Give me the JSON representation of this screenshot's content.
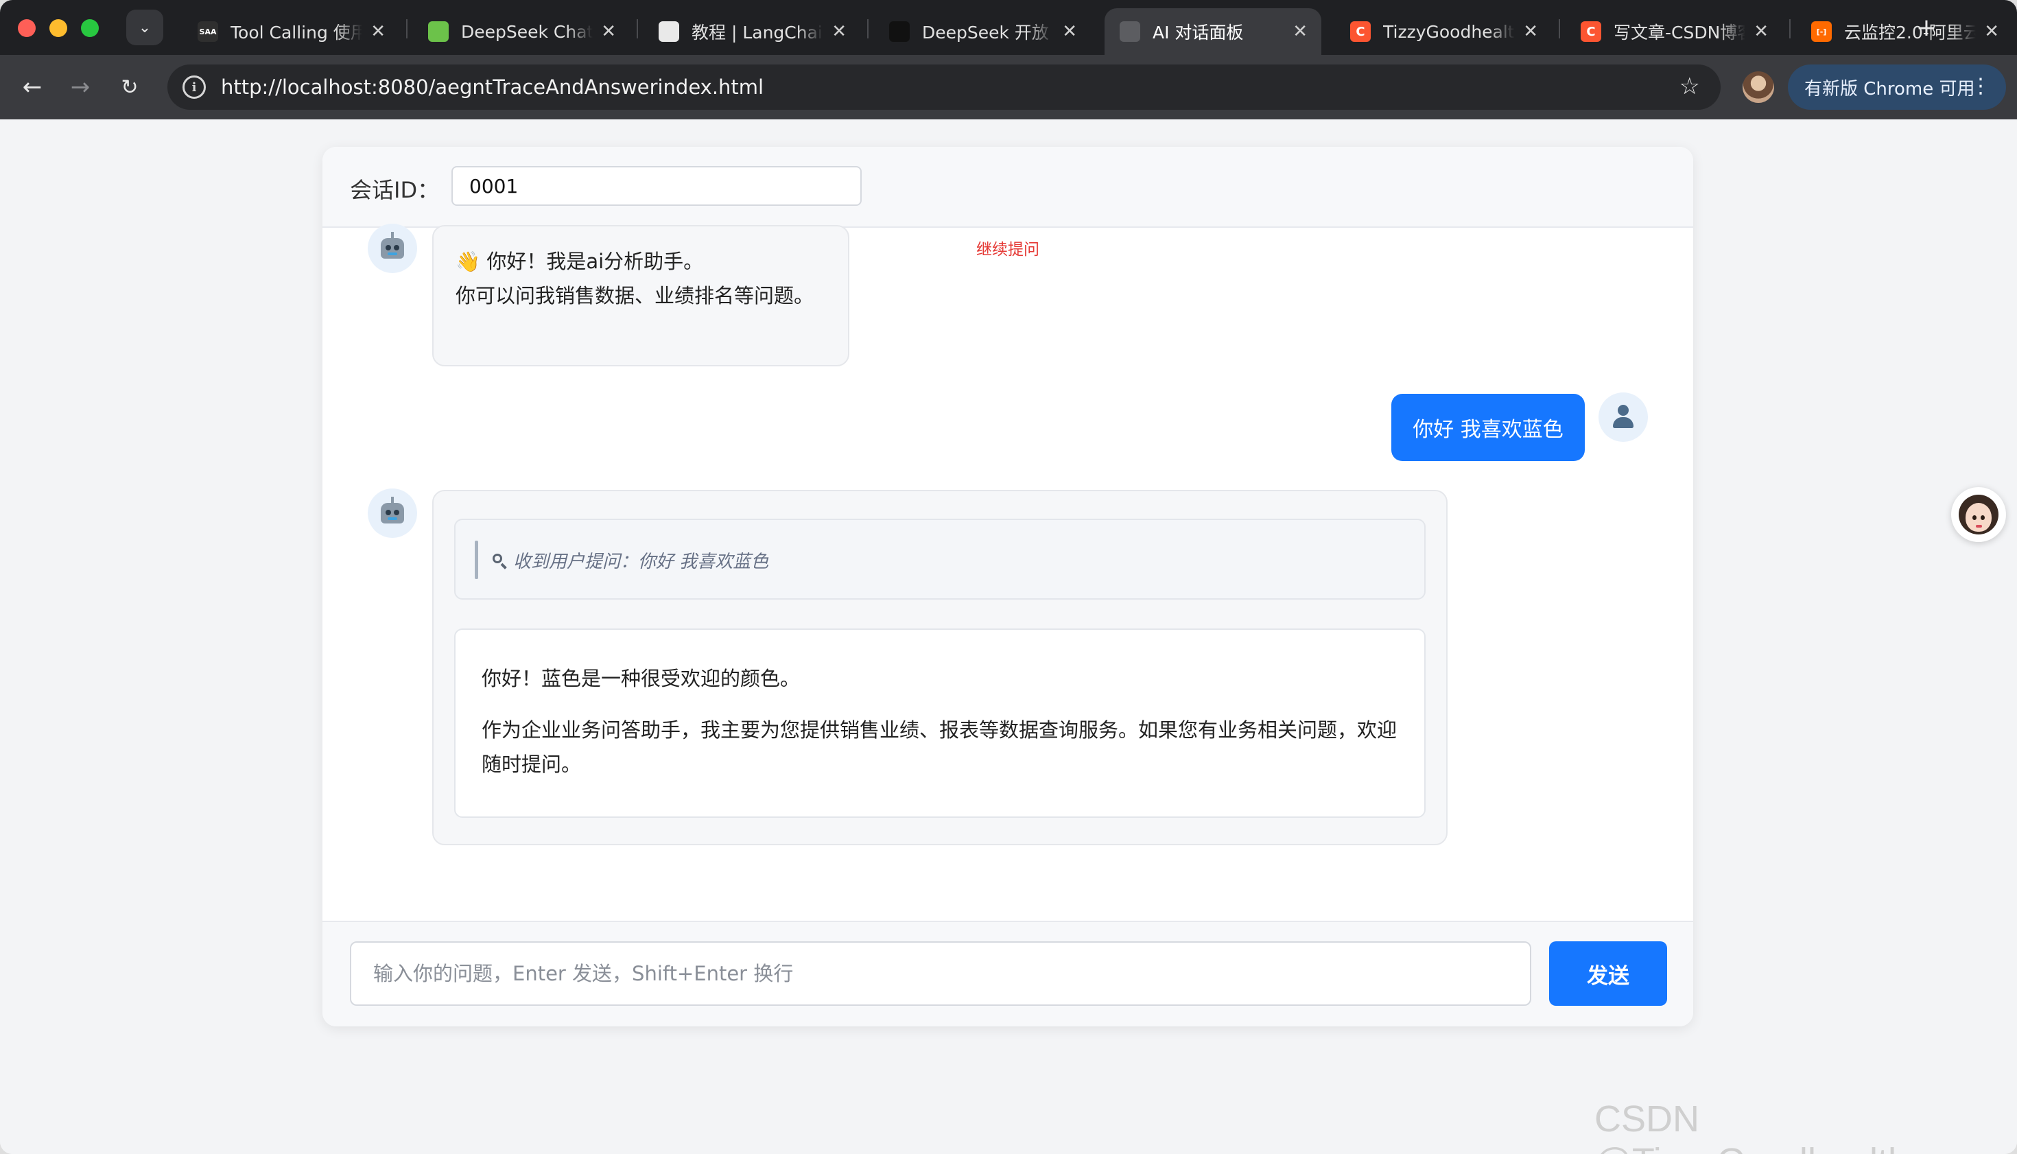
{
  "browser": {
    "tabs": [
      {
        "title": "Tool Calling 使用",
        "favicon_text": "SAA",
        "favicon_color": "#2f2f2f",
        "active": false
      },
      {
        "title": "DeepSeek Chat",
        "favicon_text": "",
        "favicon_color": "#6cc24a",
        "active": false
      },
      {
        "title": "教程 | LangChain",
        "favicon_text": "",
        "favicon_color": "#e9e9e9",
        "active": false
      },
      {
        "title": "DeepSeek 开放",
        "favicon_text": "",
        "favicon_color": "#111111",
        "active": false
      },
      {
        "title": "AI 对话面板",
        "favicon_text": "",
        "favicon_color": "#5c5d61",
        "active": true
      },
      {
        "title": "TizzyGoodhealth",
        "favicon_text": "C",
        "favicon_color": "#fc5531",
        "active": false
      },
      {
        "title": "写文章-CSDN博客",
        "favicon_text": "C",
        "favicon_color": "#fc5531",
        "active": false
      },
      {
        "title": "云监控2.0-阿里云",
        "favicon_text": "[-]",
        "favicon_color": "#ff6a00",
        "active": false
      }
    ],
    "tab_close_glyph": "✕",
    "new_tab_glyph": "+",
    "url": "http://localhost:8080/aegntTraceAndAnswerindex.html",
    "update_label": "有新版 Chrome 可用"
  },
  "chat": {
    "session_label": "会话ID：",
    "session_id": "0001",
    "continue_label": "继续提问",
    "greeting": {
      "line1": "👋 你好！我是ai分析助手。",
      "line2": "你可以问我销售数据、业绩排名等问题。"
    },
    "user_message": "你好 我喜欢蓝色",
    "trace_text": "收到用户提问：你好 我喜欢蓝色",
    "answer": {
      "para1": "你好！蓝色是一种很受欢迎的颜色。",
      "para2": "作为企业业务问答助手，我主要为您提供销售业绩、报表等数据查询服务。如果您有业务相关问题，欢迎随时提问。"
    },
    "input_placeholder": "输入你的问题，Enter 发送，Shift+Enter 换行",
    "send_label": "发送"
  },
  "watermark": "CSDN @TizzyGoodhealth",
  "colors": {
    "accent": "#1677ff",
    "continue_link": "#e53935"
  }
}
